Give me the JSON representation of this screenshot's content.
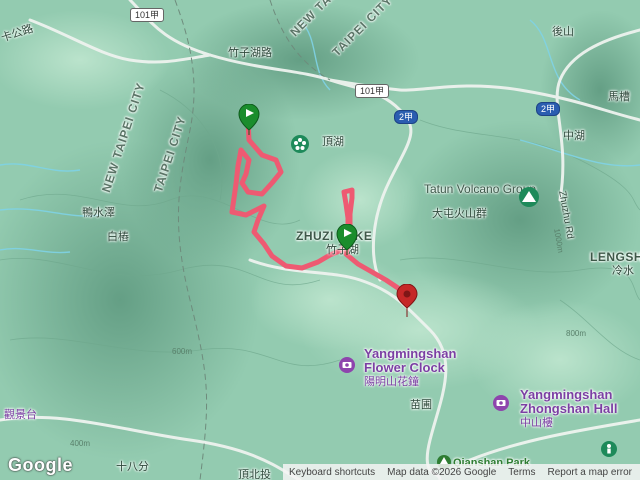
{
  "labels": {
    "road_zhuzihu": "竹子湖路",
    "dinghu": "頂湖",
    "yashuize": "鴨水澤",
    "baitan": "白樁",
    "zhuzi_lake_en": "ZHUZI LAKE",
    "zhuzi_lake_zh": "竹子湖",
    "tatun_en": "Tatun Volcano Group",
    "tatun_zh": "大屯火山群",
    "houshan": "後山",
    "machao": "馬槽",
    "zhonghu": "中湖",
    "zhuzi_rd": "Zhuzhu Rd",
    "lengshui_en": "LENGSHU",
    "lengshui_zh": "冷水",
    "flower_clock_en_1": "Yangmingshan",
    "flower_clock_en_2": "Flower Clock",
    "flower_clock_zh": "陽明山花鐘",
    "miaopu": "苗圃",
    "zhongshan_en_1": "Yangmingshan",
    "zhongshan_en_2": "Zhongshan Hall",
    "zhongshan_zh": "中山樓",
    "qianshan": "Qianshan Park",
    "shibafen": "十八分",
    "dingbeitou": "頂北投",
    "guanjingtai": "觀景台",
    "gongshan": "卡公路",
    "new_taipei_1": "NEW TAIPEI CITY",
    "taipei_1": "TAIPEI CITY",
    "new_taipei_2": "NEW TAIPEI CITY",
    "taipei_2": "TAIPEI CITY",
    "contour_800": "800m",
    "contour_600": "600m",
    "contour_400": "400m",
    "contour_1000": "1000m"
  },
  "shields": {
    "r101a_top": "101甲",
    "r101a_mid": "101甲",
    "r2a_1": "2甲",
    "r2a_2": "2甲"
  },
  "attribution": {
    "logo": "Google",
    "keyboard": "Keyboard shortcuts",
    "mapdata": "Map data ©2026 Google",
    "terms": "Terms",
    "report": "Report a map error"
  },
  "colors": {
    "route": "#ee5a72",
    "start_marker": "#1a8d2c",
    "end_marker": "#c62828",
    "poi": "#8e44ad",
    "highway": "#2a5db0"
  }
}
